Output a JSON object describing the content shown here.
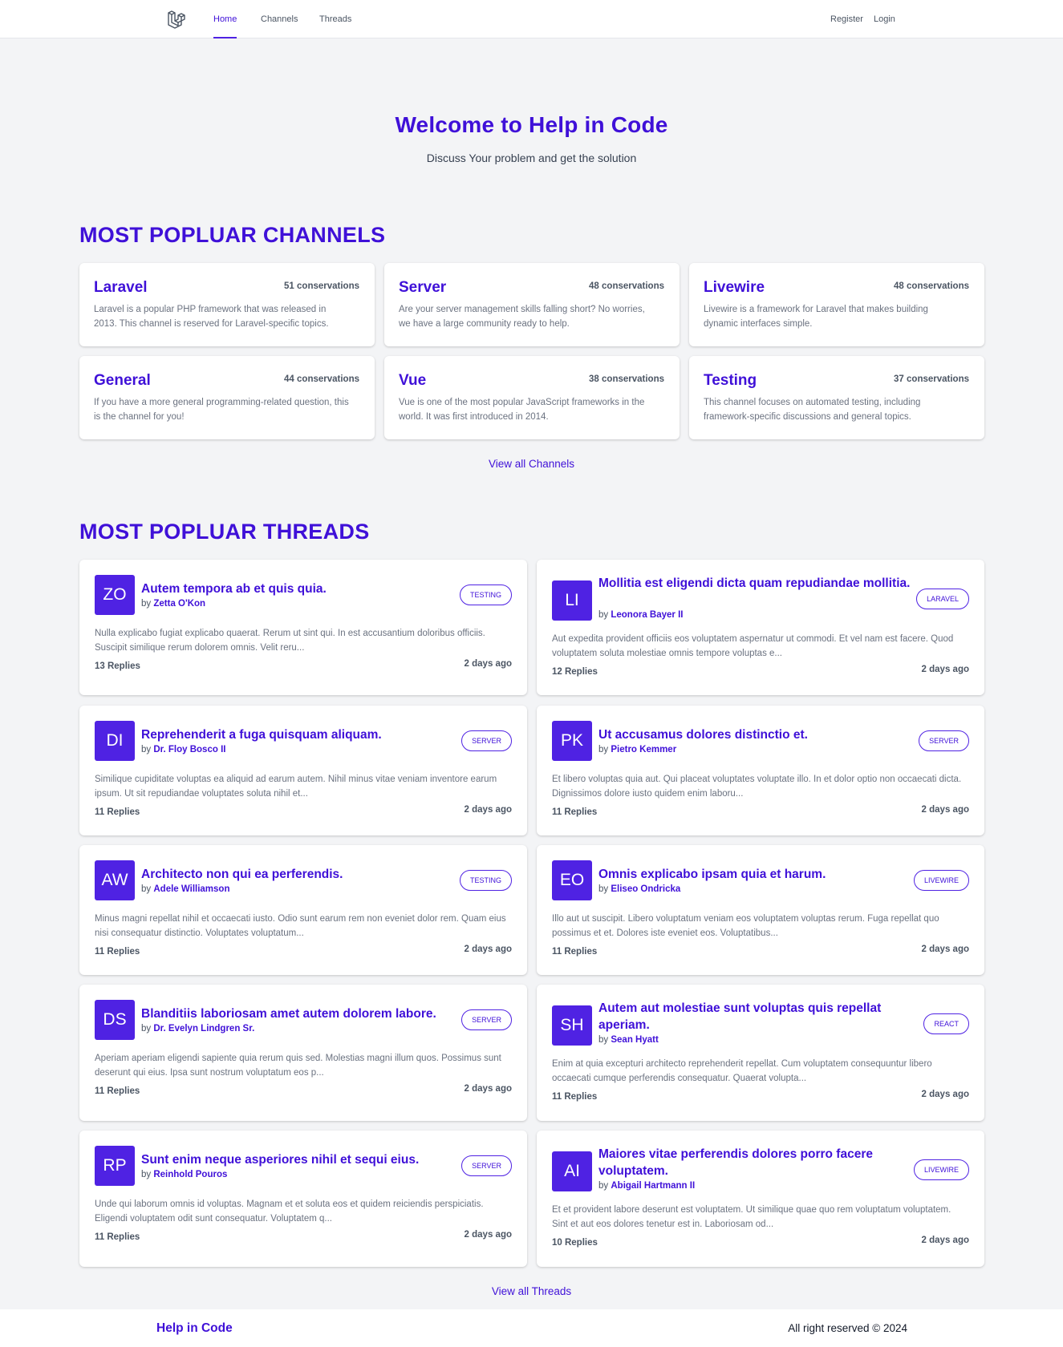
{
  "nav": {
    "home": "Home",
    "channels": "Channels",
    "threads": "Threads",
    "register": "Register",
    "login": "Login"
  },
  "hero": {
    "title": "Welcome to Help in Code",
    "subtitle": "Discuss Your problem and get the solution"
  },
  "channels_section": {
    "title": "MOST POPLUAR CHANNELS",
    "view_all": "View all Channels",
    "items": [
      {
        "name": "Laravel",
        "count": "51 conservations",
        "desc": "Laravel is a popular PHP framework that was released in 2013. This channel is reserved for Laravel-specific topics."
      },
      {
        "name": "Server",
        "count": "48 conservations",
        "desc": "Are your server management skills falling short? No worries, we have a large community ready to help."
      },
      {
        "name": "Livewire",
        "count": "48 conservations",
        "desc": "Livewire is a framework for Laravel that makes building dynamic interfaces simple."
      },
      {
        "name": "General",
        "count": "44 conservations",
        "desc": "If you have a more general programming-related question, this is the channel for you!"
      },
      {
        "name": "Vue",
        "count": "38 conservations",
        "desc": "Vue is one of the most popular JavaScript frameworks in the world. It was first introduced in 2014."
      },
      {
        "name": "Testing",
        "count": "37 conservations",
        "desc": "This channel focuses on automated testing, including framework-specific discussions and general topics."
      }
    ]
  },
  "threads_section": {
    "title": "MOST POPLUAR THREADS",
    "view_all": "View all Threads",
    "by": "by",
    "items": [
      {
        "initials": "ZO",
        "title": "Autem tempora ab et quis quia.",
        "author": "Zetta O'Kon",
        "tag": "TESTING",
        "body": "Nulla explicabo fugiat explicabo quaerat. Rerum ut sint qui. In est accusantium doloribus officiis. Suscipit similique rerum dolorem omnis. Velit reru...",
        "replies": "13 Replies",
        "time": "2 days ago"
      },
      {
        "initials": "LI",
        "title": "Mollitia est eligendi dicta quam repudiandae mollitia.",
        "author": "Leonora Bayer II",
        "tag": "LARAVEL",
        "body": "Aut expedita provident officiis eos voluptatem aspernatur ut commodi. Et vel nam est facere. Quod voluptatem soluta molestiae omnis tempore voluptas e...",
        "replies": "12 Replies",
        "time": "2 days ago"
      },
      {
        "initials": "DI",
        "title": "Reprehenderit a fuga quisquam aliquam.",
        "author": "Dr. Floy Bosco II",
        "tag": "SERVER",
        "body": "Similique cupiditate voluptas ea aliquid ad earum autem. Nihil minus vitae veniam inventore earum ipsum. Ut sit repudiandae voluptates soluta nihil et...",
        "replies": "11 Replies",
        "time": "2 days ago"
      },
      {
        "initials": "PK",
        "title": "Ut accusamus dolores distinctio et.",
        "author": "Pietro Kemmer",
        "tag": "SERVER",
        "body": "Et libero voluptas quia aut. Qui placeat voluptates voluptate illo. In et dolor optio non occaecati dicta. Dignissimos dolore iusto quidem enim laboru...",
        "replies": "11 Replies",
        "time": "2 days ago"
      },
      {
        "initials": "AW",
        "title": "Architecto non qui ea perferendis.",
        "author": "Adele Williamson",
        "tag": "TESTING",
        "body": "Minus magni repellat nihil et occaecati iusto. Odio sunt earum rem non eveniet dolor rem. Quam eius nisi consequatur distinctio. Voluptates voluptatum...",
        "replies": "11 Replies",
        "time": "2 days ago"
      },
      {
        "initials": "EO",
        "title": "Omnis explicabo ipsam quia et harum.",
        "author": "Eliseo Ondricka",
        "tag": "LIVEWIRE",
        "body": "Illo aut ut suscipit. Libero voluptatum veniam eos voluptatem voluptas rerum. Fuga repellat quo possimus et et. Dolores iste eveniet eos. Voluptatibus...",
        "replies": "11 Replies",
        "time": "2 days ago"
      },
      {
        "initials": "DS",
        "title": "Blanditiis laboriosam amet autem dolorem labore.",
        "author": "Dr. Evelyn Lindgren Sr.",
        "tag": "SERVER",
        "body": "Aperiam aperiam eligendi sapiente quia rerum quis sed. Molestias magni illum quos. Possimus sunt deserunt qui eius. Ipsa sunt nostrum voluptatum eos p...",
        "replies": "11 Replies",
        "time": "2 days ago"
      },
      {
        "initials": "SH",
        "title": "Autem aut molestiae sunt voluptas quis repellat aperiam.",
        "author": "Sean Hyatt",
        "tag": "REACT",
        "body": "Enim at quia excepturi architecto reprehenderit repellat. Cum voluptatem consequuntur libero occaecati cumque perferendis consequatur. Quaerat volupta...",
        "replies": "11 Replies",
        "time": "2 days ago"
      },
      {
        "initials": "RP",
        "title": "Sunt enim neque asperiores nihil et sequi eius.",
        "author": "Reinhold Pouros",
        "tag": "SERVER",
        "body": "Unde qui laborum omnis id voluptas. Magnam et et soluta eos et quidem reiciendis perspiciatis. Eligendi voluptatem odit sunt consequatur. Voluptatem q...",
        "replies": "11 Replies",
        "time": "2 days ago"
      },
      {
        "initials": "AI",
        "title": "Maiores vitae perferendis dolores porro facere voluptatem.",
        "author": "Abigail Hartmann II",
        "tag": "LIVEWIRE",
        "body": "Et et provident labore deserunt est voluptatem. Ut similique quae quo rem voluptatum voluptatem. Sint et aut eos dolores tenetur est in. Laboriosam od...",
        "replies": "10 Replies",
        "time": "2 days ago"
      }
    ]
  },
  "footer": {
    "brand": "Help in Code",
    "copyright": "All right reserved © 2024"
  },
  "colors": {
    "accent": "#3f10d8",
    "avatar_bg": "#4f22e3",
    "page_bg": "#f3f4f6"
  },
  "icons": {
    "logo": "laravel-logo-icon"
  }
}
